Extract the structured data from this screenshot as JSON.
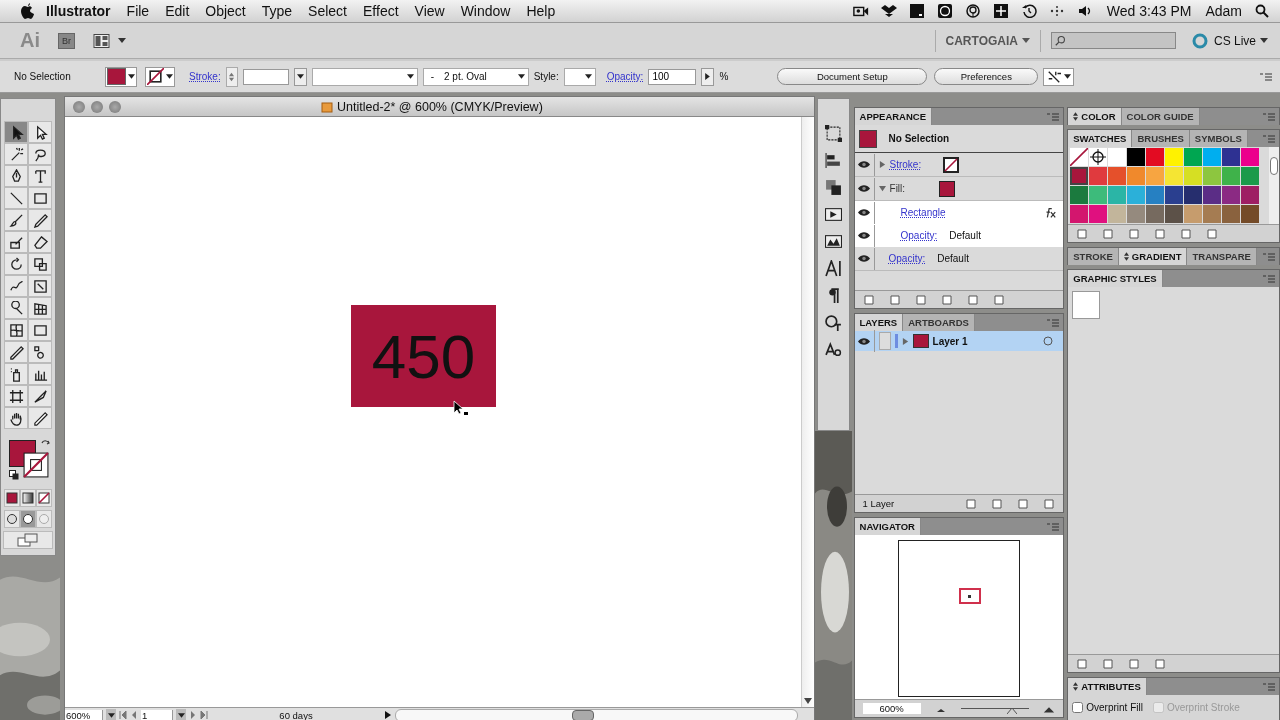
{
  "menu_bar": {
    "app": "Illustrator",
    "menus": [
      "File",
      "Edit",
      "Object",
      "Type",
      "Select",
      "Effect",
      "View",
      "Window",
      "Help"
    ],
    "clock": "Wed 3:43 PM",
    "user": "Adam"
  },
  "app_bar": {
    "logo": "Ai",
    "bridge": "Br",
    "workspace": "CARTOGAIA",
    "cs_live": "CS Live"
  },
  "control_bar": {
    "selection": "No Selection",
    "stroke_label": "Stroke:",
    "brush_prefix": "-",
    "brush": "2 pt. Oval",
    "style_label": "Style:",
    "opacity_label": "Opacity:",
    "opacity": "100",
    "percent": "%",
    "buttons": [
      "Document Setup",
      "Preferences"
    ]
  },
  "toolbox": {
    "tools": [
      {
        "selected": true
      },
      {
        "selected": false
      },
      {
        "selected": false
      },
      {
        "selected": false
      },
      {
        "selected": false
      },
      {
        "selected": false
      },
      {
        "selected": false
      },
      {
        "selected": false
      },
      {
        "selected": false
      },
      {
        "selected": false
      },
      {
        "selected": false
      },
      {
        "selected": false
      },
      {
        "selected": false
      },
      {
        "selected": false
      },
      {
        "selected": false
      },
      {
        "selected": false
      },
      {
        "selected": false
      },
      {
        "selected": false
      },
      {
        "selected": false
      },
      {
        "selected": false
      },
      {
        "selected": false
      },
      {
        "selected": false
      },
      {
        "selected": false
      },
      {
        "selected": false
      },
      {
        "selected": false
      },
      {
        "selected": false
      },
      {
        "selected": false
      },
      {
        "selected": false
      }
    ]
  },
  "document": {
    "title": "Untitled-2* @ 600% (CMYK/Preview)",
    "shape": {
      "text": "450",
      "color": "#a8163c"
    },
    "zoom": "600%",
    "page": "1",
    "status": "60 days"
  },
  "appearance": {
    "tabs": [
      {
        "label": "APPEARANCE",
        "selected": true
      }
    ],
    "header": "No Selection",
    "color": "#a8163c",
    "rows": [
      {
        "kind": "stroke",
        "label": "Stroke:",
        "visible": true,
        "expanded": false
      },
      {
        "kind": "fill",
        "label": "Fill:",
        "visible": true,
        "expanded": true,
        "color": "#a8163c",
        "children": [
          {
            "kind": "effect",
            "label": "Rectangle",
            "visible": true
          },
          {
            "kind": "opacity",
            "label": "Opacity:",
            "value": "Default",
            "visible": true
          }
        ]
      },
      {
        "kind": "opacity",
        "label": "Opacity:",
        "value": "Default",
        "visible": true
      }
    ]
  },
  "layers": {
    "tabs": [
      {
        "label": "LAYERS",
        "selected": true
      },
      {
        "label": "ARTBOARDS",
        "selected": false
      }
    ],
    "items": [
      {
        "name": "Layer 1",
        "selected": true,
        "expanded": false,
        "visible": true
      }
    ],
    "count": "1 Layer"
  },
  "navigator": {
    "tabs": [
      {
        "label": "NAVIGATOR",
        "selected": true
      }
    ],
    "zoom": "600%",
    "slider": {
      "level": 0.75
    }
  },
  "color": {
    "minimizable": true,
    "tabs": [
      {
        "label": "COLOR",
        "selected": true
      },
      {
        "label": "COLOR GUIDE",
        "selected": false
      }
    ]
  },
  "swatches": {
    "minimizable": false,
    "tabs": [
      {
        "label": "SWATCHES",
        "selected": true
      },
      {
        "label": "BRUSHES",
        "selected": false
      },
      {
        "label": "SYMBOLS",
        "selected": false
      }
    ],
    "items": [
      {
        "kind": "none",
        "selected": false
      },
      {
        "kind": "registration",
        "selected": false
      },
      {
        "kind": "color",
        "color": "#ffffff",
        "selected": false
      },
      {
        "kind": "color",
        "color": "#000000",
        "selected": false
      },
      {
        "kind": "color",
        "color": "#e30b22",
        "selected": false
      },
      {
        "kind": "color",
        "color": "#fff200",
        "selected": false
      },
      {
        "kind": "color",
        "color": "#00a651",
        "selected": false
      },
      {
        "kind": "color",
        "color": "#00aeef",
        "selected": false
      },
      {
        "kind": "color",
        "color": "#2e3192",
        "selected": false
      },
      {
        "kind": "color",
        "color": "#ec008c",
        "selected": false
      },
      {
        "kind": "color",
        "color": "#a8163c",
        "selected": true
      },
      {
        "kind": "color",
        "color": "#e03a3e",
        "selected": false
      },
      {
        "kind": "color",
        "color": "#e5502b",
        "selected": false
      },
      {
        "kind": "color",
        "color": "#f0892c",
        "selected": false
      },
      {
        "kind": "color",
        "color": "#f7a541",
        "selected": false
      },
      {
        "kind": "color",
        "color": "#f5e533",
        "selected": false
      },
      {
        "kind": "color",
        "color": "#d6df23",
        "selected": false
      },
      {
        "kind": "color",
        "color": "#8dc63f",
        "selected": false
      },
      {
        "kind": "color",
        "color": "#3fb24a",
        "selected": false
      },
      {
        "kind": "color",
        "color": "#1a9a4a",
        "selected": false
      },
      {
        "kind": "color",
        "color": "#1b7a3e",
        "selected": false
      },
      {
        "kind": "color",
        "color": "#3dbb7b",
        "selected": false
      },
      {
        "kind": "color",
        "color": "#2bb5a6",
        "selected": false
      },
      {
        "kind": "color",
        "color": "#2bb0d9",
        "selected": false
      },
      {
        "kind": "color",
        "color": "#2680c2",
        "selected": false
      },
      {
        "kind": "color",
        "color": "#2a3f8f",
        "selected": false
      },
      {
        "kind": "color",
        "color": "#262e6e",
        "selected": false
      },
      {
        "kind": "color",
        "color": "#5b2d86",
        "selected": false
      },
      {
        "kind": "color",
        "color": "#8b2a83",
        "selected": false
      },
      {
        "kind": "color",
        "color": "#9e1f63",
        "selected": false
      },
      {
        "kind": "color",
        "color": "#d3166e",
        "selected": false
      },
      {
        "kind": "color",
        "color": "#e0107f",
        "selected": false
      },
      {
        "kind": "color",
        "color": "#c2b59b",
        "selected": false
      },
      {
        "kind": "color",
        "color": "#958a7e",
        "selected": false
      },
      {
        "kind": "color",
        "color": "#766a5f",
        "selected": false
      },
      {
        "kind": "color",
        "color": "#5c5148",
        "selected": false
      },
      {
        "kind": "color",
        "color": "#c69c6d",
        "selected": false
      },
      {
        "kind": "color",
        "color": "#a57c52",
        "selected": false
      },
      {
        "kind": "color",
        "color": "#8a623e",
        "selected": false
      },
      {
        "kind": "color",
        "color": "#744b28",
        "selected": false
      }
    ]
  },
  "stroke_gradient": {
    "minimizable": true,
    "tabs": [
      {
        "label": "STROKE",
        "selected": false
      },
      {
        "label": "GRADIENT",
        "selected": true
      },
      {
        "label": "TRANSPARE",
        "selected": false
      }
    ]
  },
  "graphic_styles": {
    "minimizable": false,
    "tabs": [
      {
        "label": "GRAPHIC STYLES",
        "selected": true
      }
    ]
  },
  "attributes": {
    "minimizable": true,
    "tabs": [
      {
        "label": "ATTRIBUTES",
        "selected": true
      }
    ],
    "options": [
      {
        "label": "Overprint Fill",
        "checked": false,
        "disabled": false
      },
      {
        "label": "Overprint Stroke",
        "checked": false,
        "disabled": true
      }
    ]
  }
}
